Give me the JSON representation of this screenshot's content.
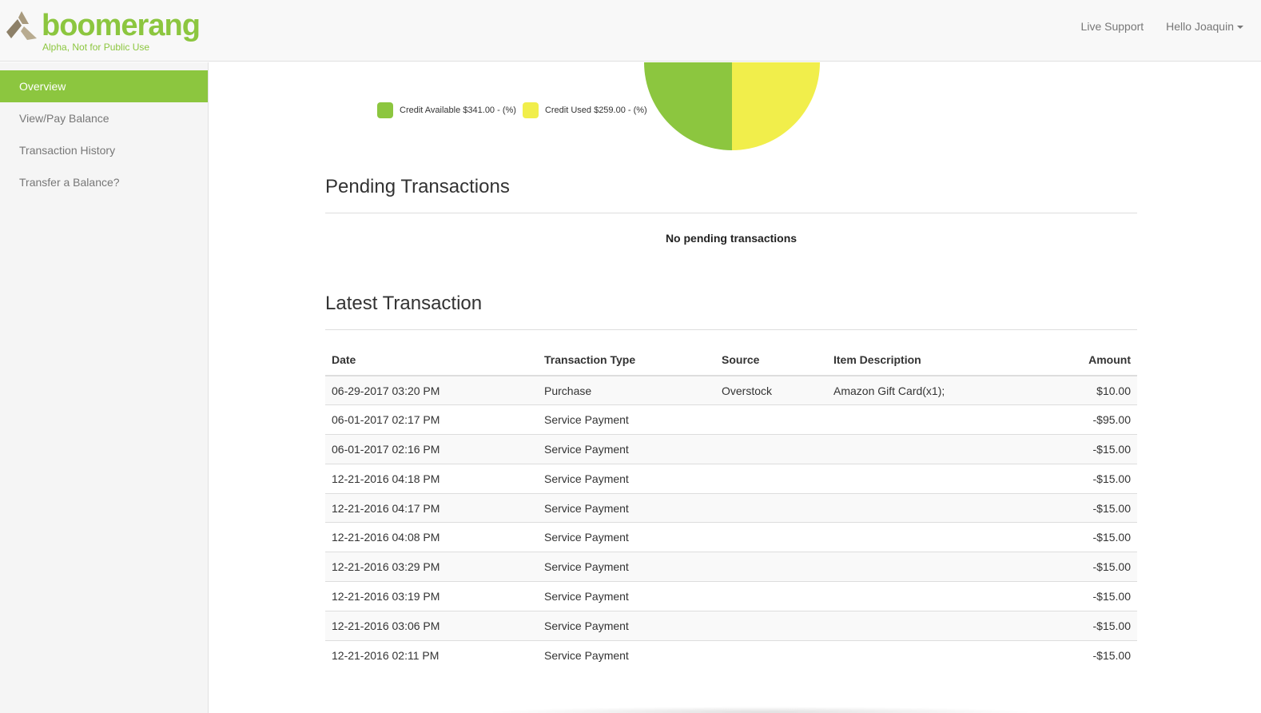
{
  "header": {
    "brand_name": "boomerang",
    "brand_tagline": "Alpha, Not for Public Use",
    "live_support": "Live Support",
    "user_greeting": "Hello Joaquin"
  },
  "sidebar": {
    "items": [
      {
        "label": "Overview",
        "active": true
      },
      {
        "label": "View/Pay Balance",
        "active": false
      },
      {
        "label": "Transaction History",
        "active": false
      },
      {
        "label": "Transfer a Balance?",
        "active": false
      }
    ]
  },
  "colors": {
    "accent": "#8cc63f",
    "credit_used": "#f1ee4b"
  },
  "chart_data": {
    "type": "pie",
    "series": [
      {
        "name": "Credit Available",
        "value": 341.0
      },
      {
        "name": "Credit Used",
        "value": 259.0
      }
    ],
    "legend": [
      "Credit Available $341.00 - (%)",
      "Credit Used $259.00 - (%)"
    ]
  },
  "pending": {
    "title": "Pending Transactions",
    "empty_message": "No pending transactions"
  },
  "latest": {
    "title": "Latest Transaction",
    "columns": [
      "Date",
      "Transaction Type",
      "Source",
      "Item Description",
      "Amount"
    ],
    "rows": [
      [
        "06-29-2017 03:20 PM",
        "Purchase",
        "Overstock",
        "Amazon Gift Card(x1);",
        "$10.00"
      ],
      [
        "06-01-2017 02:17 PM",
        "Service Payment",
        "",
        "",
        "-$95.00"
      ],
      [
        "06-01-2017 02:16 PM",
        "Service Payment",
        "",
        "",
        "-$15.00"
      ],
      [
        "12-21-2016 04:18 PM",
        "Service Payment",
        "",
        "",
        "-$15.00"
      ],
      [
        "12-21-2016 04:17 PM",
        "Service Payment",
        "",
        "",
        "-$15.00"
      ],
      [
        "12-21-2016 04:08 PM",
        "Service Payment",
        "",
        "",
        "-$15.00"
      ],
      [
        "12-21-2016 03:29 PM",
        "Service Payment",
        "",
        "",
        "-$15.00"
      ],
      [
        "12-21-2016 03:19 PM",
        "Service Payment",
        "",
        "",
        "-$15.00"
      ],
      [
        "12-21-2016 03:06 PM",
        "Service Payment",
        "",
        "",
        "-$15.00"
      ],
      [
        "12-21-2016 02:11 PM",
        "Service Payment",
        "",
        "",
        "-$15.00"
      ]
    ]
  }
}
